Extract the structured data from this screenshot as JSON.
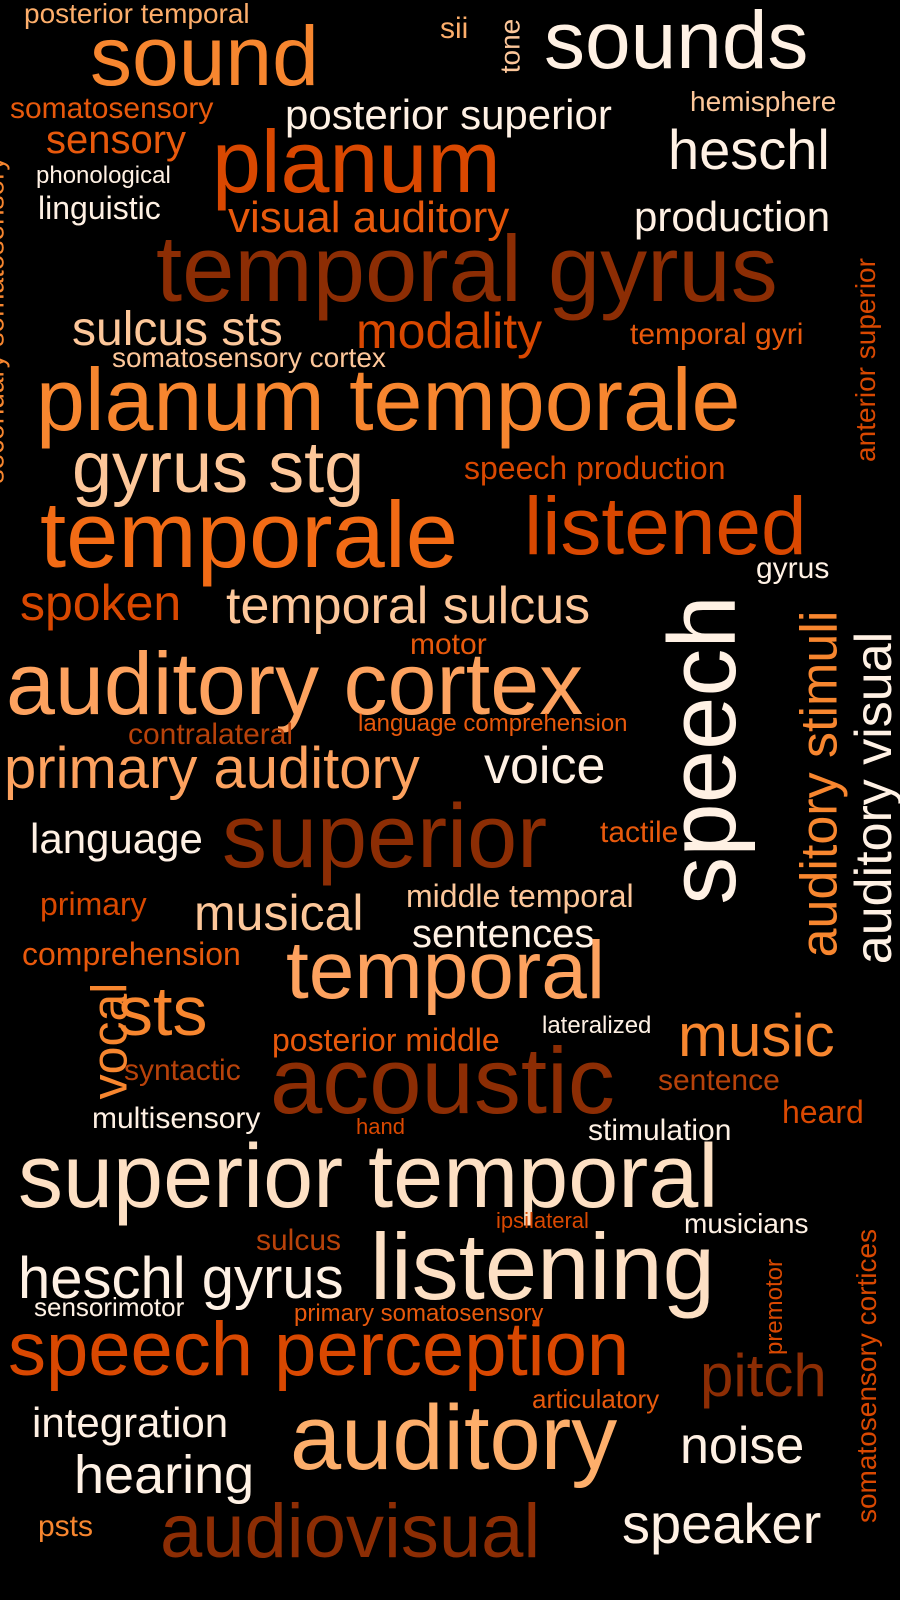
{
  "colors": {
    "background": "#000000",
    "cream": "#fff1e4",
    "peach": "#fdc79a",
    "light_orange": "#fda25f",
    "orange": "#f7862f",
    "dark_orange": "#e8590c",
    "red_orange": "#d94801",
    "rust": "#b8420a",
    "brown": "#8c2d04"
  },
  "words": [
    "posterior temporal",
    "sound",
    "sii",
    "tone",
    "sounds",
    "somatosensory",
    "posterior superior",
    "hemisphere",
    "sensory",
    "heschl",
    "phonological",
    "planum",
    "linguistic",
    "visual auditory",
    "production",
    "secondary somatosensory",
    "temporal gyrus",
    "anterior superior",
    "sulcus sts",
    "modality",
    "temporal gyri",
    "somatosensory cortex",
    "planum temporale",
    "gyrus stg",
    "speech production",
    "temporale",
    "listened",
    "gyrus",
    "spoken",
    "temporal sulcus",
    "speech",
    "auditory stimuli",
    "auditory visual",
    "motor",
    "auditory cortex",
    "language comprehension",
    "contralateral",
    "primary auditory",
    "voice",
    "language",
    "superior",
    "tactile",
    "primary",
    "musical",
    "middle temporal",
    "sentences",
    "comprehension",
    "temporal",
    "vocal",
    "sts",
    "lateralized",
    "music",
    "posterior middle",
    "syntactic",
    "acoustic",
    "sentence",
    "heard",
    "multisensory",
    "hand",
    "stimulation",
    "superior temporal",
    "ipsilateral",
    "musicians",
    "sulcus",
    "listening",
    "heschl gyrus",
    "sensorimotor",
    "primary somatosensory",
    "premotor",
    "somatosensory cortices",
    "speech perception",
    "pitch",
    "articulatory",
    "integration",
    "auditory",
    "noise",
    "hearing",
    "psts",
    "audiovisual",
    "speaker"
  ]
}
